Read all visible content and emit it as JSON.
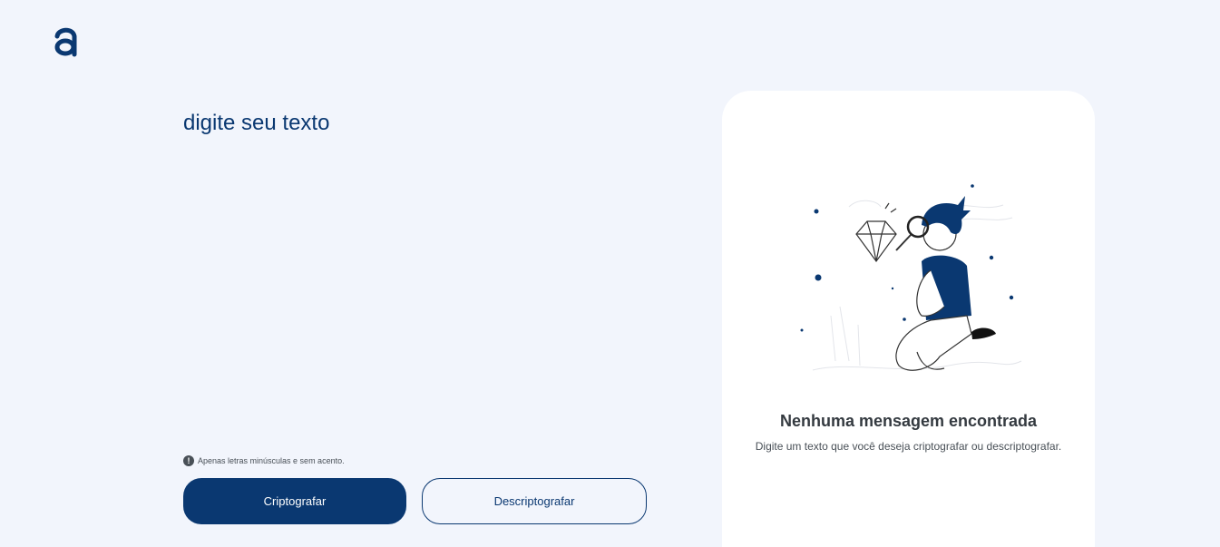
{
  "input": {
    "placeholder": "digite seu texto"
  },
  "hint": {
    "text": "Apenas letras minúsculas e sem acento.",
    "icon": "exclamation-circle-icon"
  },
  "buttons": {
    "encrypt_label": "Criptografar",
    "decrypt_label": "Descriptografar"
  },
  "result_panel": {
    "title": "Nenhuma mensagem encontrada",
    "subtitle": "Digite um texto que você deseja criptografar ou descriptografar."
  },
  "colors": {
    "background": "#f2f5fc",
    "primary": "#0a3871",
    "panel": "#ffffff",
    "title_text": "#343a40",
    "muted_text": "#495057"
  }
}
